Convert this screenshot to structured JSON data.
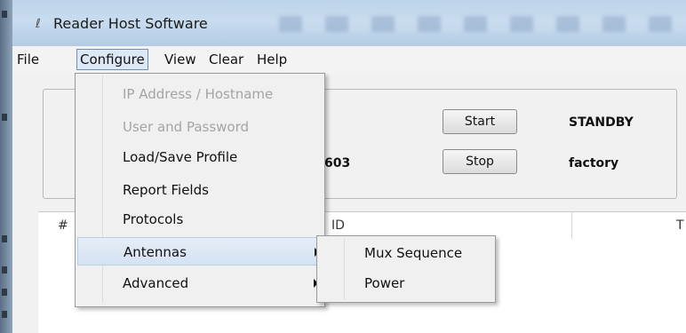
{
  "window": {
    "title": "Reader Host Software",
    "icon": "app-icon"
  },
  "menubar": [
    "File",
    "Configure",
    "View",
    "Clear",
    "Help"
  ],
  "controls": {
    "start_label": "Start",
    "stop_label": "Stop",
    "status_text": "STANDBY",
    "profile_text": "factory",
    "partial_field": "603"
  },
  "table": {
    "headers": [
      "#",
      "ID",
      "T"
    ]
  },
  "configure_menu": {
    "items": [
      {
        "label": "IP Address / Hostname",
        "enabled": false,
        "has_submenu": false
      },
      {
        "label": "User and Password",
        "enabled": false,
        "has_submenu": false
      },
      {
        "label": "Load/Save Profile",
        "enabled": true,
        "has_submenu": false
      },
      {
        "label": "Report Fields",
        "enabled": true,
        "has_submenu": false
      },
      {
        "label": "Protocols",
        "enabled": true,
        "has_submenu": false
      },
      {
        "label": "Antennas",
        "enabled": true,
        "has_submenu": true,
        "highlighted": true
      },
      {
        "label": "Advanced",
        "enabled": true,
        "has_submenu": true
      }
    ]
  },
  "antennas_submenu": {
    "items": [
      "Mux Sequence",
      "Power"
    ]
  },
  "colors": {
    "titlebar": "#bcd3ea",
    "menu_highlight": "#dde8f5",
    "disabled_text": "#a4a4a4"
  }
}
